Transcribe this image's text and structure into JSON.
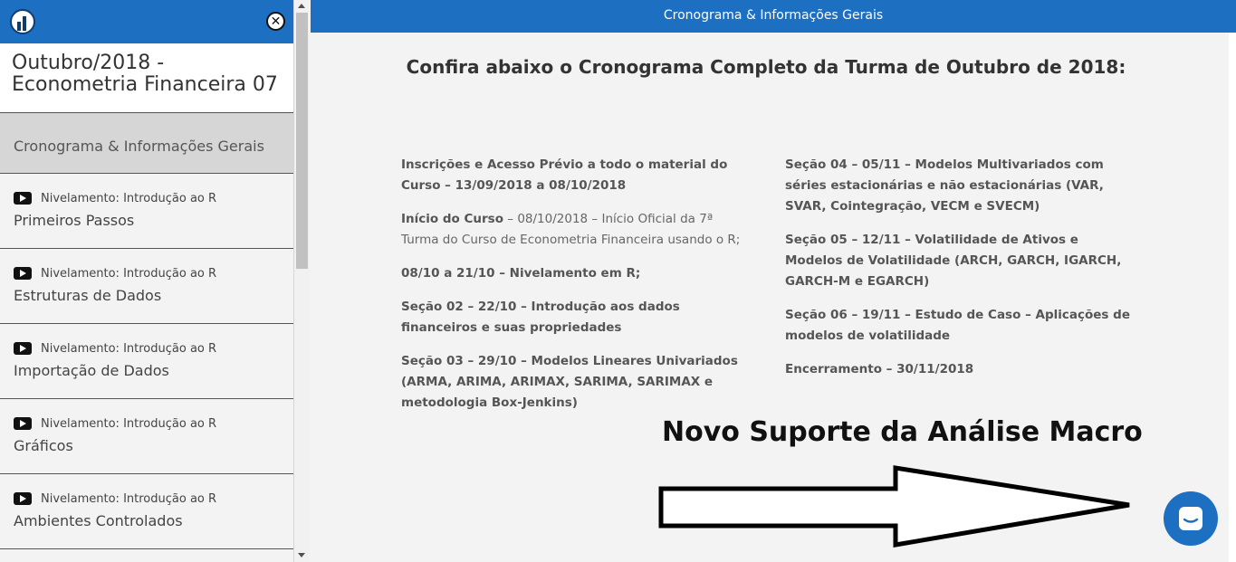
{
  "sidebar": {
    "course_title_line1": "Outubro/2018 -",
    "course_title_line2": "Econometria Financeira 07",
    "active_item": "Cronograma & Informações Gerais",
    "lessons": [
      {
        "subtitle": "Nivelamento: Introdução ao R",
        "title": "Primeiros Passos"
      },
      {
        "subtitle": "Nivelamento: Introdução ao R",
        "title": "Estruturas de Dados"
      },
      {
        "subtitle": "Nivelamento: Introdução ao R",
        "title": "Importação de Dados"
      },
      {
        "subtitle": "Nivelamento: Introdução ao R",
        "title": "Gráficos"
      },
      {
        "subtitle": "Nivelamento: Introdução ao R",
        "title": "Ambientes Controlados"
      }
    ]
  },
  "topbar": {
    "title": "Cronograma & Informações Gerais"
  },
  "main": {
    "heading": "Confira abaixo o Cronograma Completo da Turma de Outubro de 2018:",
    "left_col": [
      {
        "bold": "Inscrições e Acesso Prévio a todo o material do Curso – 13/09/2018 a 08/10/2018",
        "normal": ""
      },
      {
        "bold": "Início do Curso",
        "normal": " – 08/10/2018 – Início Oficial da 7ª Turma do Curso de Econometria Financeira usando o R;"
      },
      {
        "bold": "08/10 a 21/10 – Nivelamento em R;",
        "normal": ""
      },
      {
        "bold": "Seção 02 – 22/10 – Introdução aos dados financeiros e suas propriedades",
        "normal": ""
      },
      {
        "bold": "Seção 03 – 29/10 – Modelos Lineares Univariados (ARMA, ARIMA, ARIMAX, SARIMA, SARIMAX e metodologia Box-Jenkins)",
        "normal": ""
      }
    ],
    "right_col": [
      {
        "bold": "Seção 04 – 05/11 – Modelos Multivariados com séries estacionárias e não estacionárias (VAR, SVAR, Cointegração, VECM e SVECM)"
      },
      {
        "bold": "Seção 05 – 12/11 – Volatilidade de Ativos e Modelos de Volatilidade (ARCH, GARCH, IGARCH, GARCH-M e EGARCH)"
      },
      {
        "bold": "Seção 06 – 19/11 – Estudo de Caso – Aplicações de modelos de volatilidade"
      },
      {
        "bold": "Encerramento – 30/11/2018"
      }
    ],
    "promo": "Novo Suporte da Análise Macro"
  },
  "colors": {
    "brand_blue": "#1d6fc1",
    "background": "#f3f3f3"
  }
}
